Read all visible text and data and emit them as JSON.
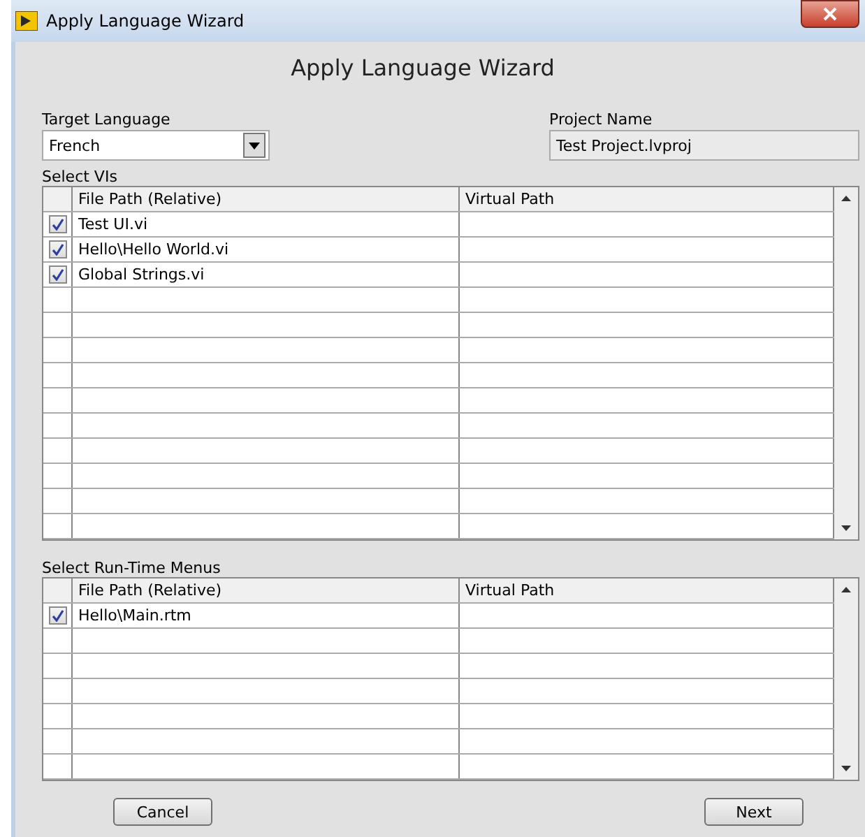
{
  "window": {
    "title": "Apply Language Wizard"
  },
  "heading": "Apply Language Wizard",
  "target_language": {
    "label": "Target Language",
    "value": "French"
  },
  "project_name": {
    "label": "Project Name",
    "value": "Test Project.lvproj"
  },
  "tables": [
    {
      "label": "Select VIs",
      "columns": [
        "File Path (Relative)",
        "Virtual Path"
      ],
      "rows": [
        {
          "checked": true,
          "file_path": "Test UI.vi"
        },
        {
          "checked": true,
          "file_path": "Hello\\Hello World.vi"
        },
        {
          "checked": true,
          "file_path": "Global Strings.vi"
        }
      ]
    },
    {
      "label": "Select Run-Time Menus",
      "columns": [
        "File Path (Relative)",
        "Virtual Path"
      ],
      "rows": [
        {
          "checked": true,
          "file_path": "Hello\\Main.rtm"
        }
      ]
    }
  ],
  "buttons": [
    "Cancel",
    "Next"
  ]
}
